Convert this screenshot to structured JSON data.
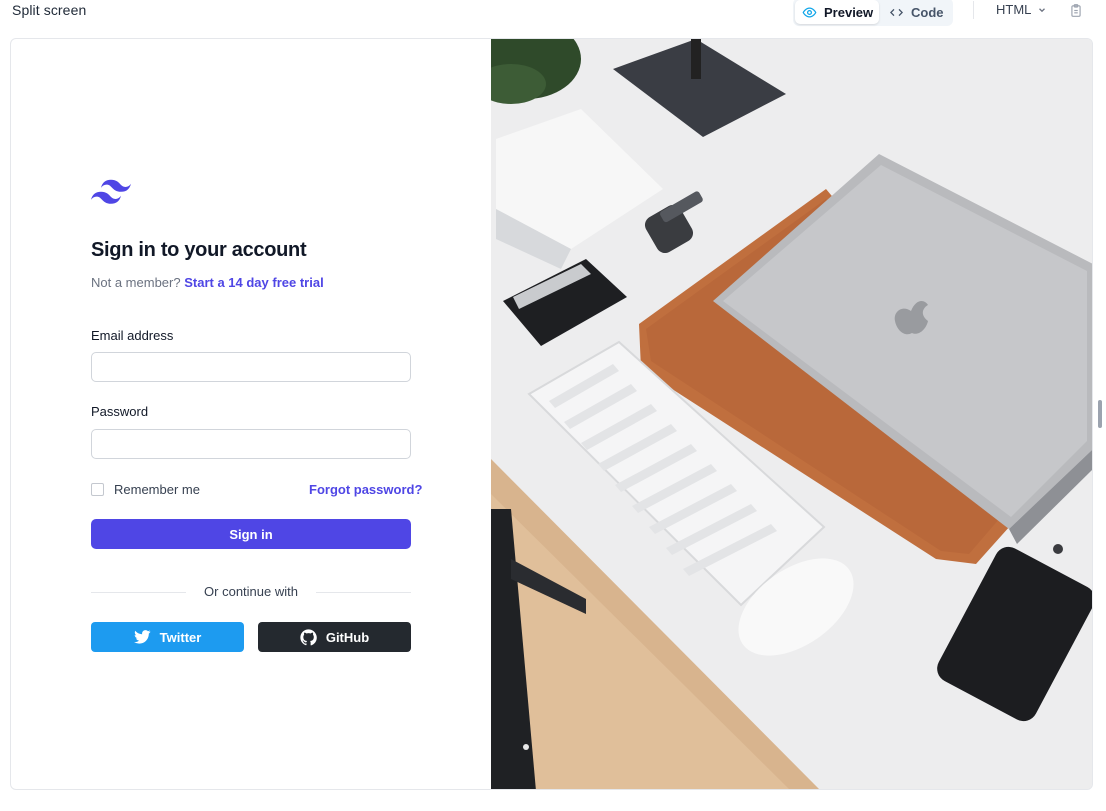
{
  "toolbar": {
    "title": "Split screen",
    "preview_label": "Preview",
    "code_label": "Code",
    "language": "HTML"
  },
  "form": {
    "heading": "Sign in to your account",
    "not_member": "Not a member?",
    "trial_link": "Start a 14 day free trial",
    "email_label": "Email address",
    "email_value": "",
    "password_label": "Password",
    "password_value": "",
    "remember_label": "Remember me",
    "forgot_label": "Forgot password?",
    "signin_label": "Sign in",
    "continue_label": "Or continue with",
    "twitter_label": "Twitter",
    "github_label": "GitHub"
  },
  "colors": {
    "accent": "#4f46e5",
    "twitter": "#1d9bf0",
    "github": "#24292f"
  },
  "icons": [
    "eye-icon",
    "code-icon",
    "chevron-down-icon",
    "clipboard-icon",
    "tailwind-logo",
    "twitter-icon",
    "github-icon"
  ]
}
